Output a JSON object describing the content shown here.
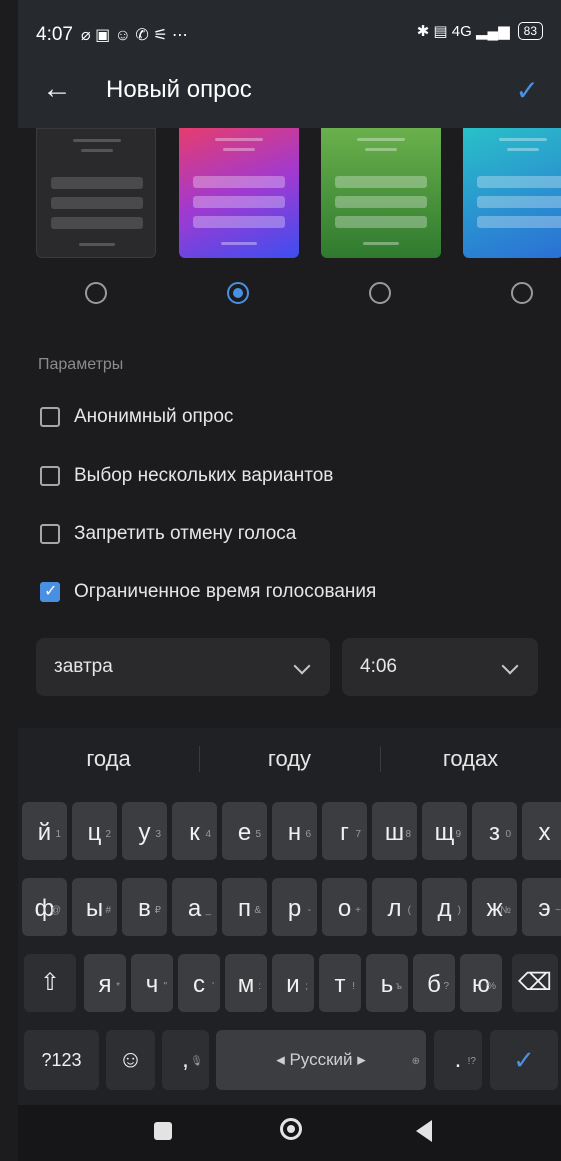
{
  "status_bar": {
    "time": "4:07",
    "left_icons": "⌀ ▣ ☺ ✆ ⚟ ⋯",
    "right_icons": "✱ ▤ 4G ▂▄▆",
    "battery": "83"
  },
  "app_bar": {
    "title": "Новый опрос",
    "back_icon": "arrow-left-icon",
    "confirm_icon": "check-icon"
  },
  "themes": {
    "selected_index": 1,
    "items": [
      "dark",
      "pink-blue",
      "green",
      "cyan-blue"
    ]
  },
  "params": {
    "heading": "Параметры",
    "options": [
      {
        "label": "Анонимный опрос",
        "checked": false
      },
      {
        "label": "Выбор нескольких вариантов",
        "checked": false
      },
      {
        "label": "Запретить отмену голоса",
        "checked": false
      },
      {
        "label": "Ограниченное время голосования",
        "checked": true
      }
    ],
    "date_value": "завтра",
    "time_value": "4:06"
  },
  "keyboard": {
    "suggestions": [
      "года",
      "году",
      "годах"
    ],
    "row1": [
      [
        "й",
        "1"
      ],
      [
        "ц",
        "2"
      ],
      [
        "у",
        "3"
      ],
      [
        "к",
        "4"
      ],
      [
        "е",
        "5"
      ],
      [
        "н",
        "6"
      ],
      [
        "г",
        "7"
      ],
      [
        "ш",
        "8"
      ],
      [
        "щ",
        "9"
      ],
      [
        "з",
        "0"
      ],
      [
        "х",
        ""
      ]
    ],
    "row2": [
      [
        "ф",
        "@"
      ],
      [
        "ы",
        "#"
      ],
      [
        "в",
        "₽"
      ],
      [
        "а",
        "_"
      ],
      [
        "п",
        "&"
      ],
      [
        "р",
        "-"
      ],
      [
        "о",
        "+"
      ],
      [
        "л",
        "("
      ],
      [
        "д",
        ")"
      ],
      [
        "ж",
        "№"
      ],
      [
        "э",
        "~"
      ]
    ],
    "row3": [
      [
        "я",
        "*"
      ],
      [
        "ч",
        "\""
      ],
      [
        "с",
        "'"
      ],
      [
        "м",
        ":"
      ],
      [
        "и",
        ";"
      ],
      [
        "т",
        "!"
      ],
      [
        "ь",
        "ъ"
      ],
      [
        "б",
        "?"
      ],
      [
        "ю",
        "%"
      ]
    ],
    "shift_label": "⇧",
    "backspace_label": "⌫",
    "symbols_label": "?123",
    "emoji_label": "☺",
    "comma_label": ",",
    "mic_hint": "🎙",
    "space_label": "◂ Русский ▸",
    "globe_hint": "⊕",
    "period_label": ".",
    "period_hint": "!?",
    "enter_label": "✓"
  },
  "colors": {
    "accent": "#4a90e2",
    "background": "#1c1c1e"
  }
}
